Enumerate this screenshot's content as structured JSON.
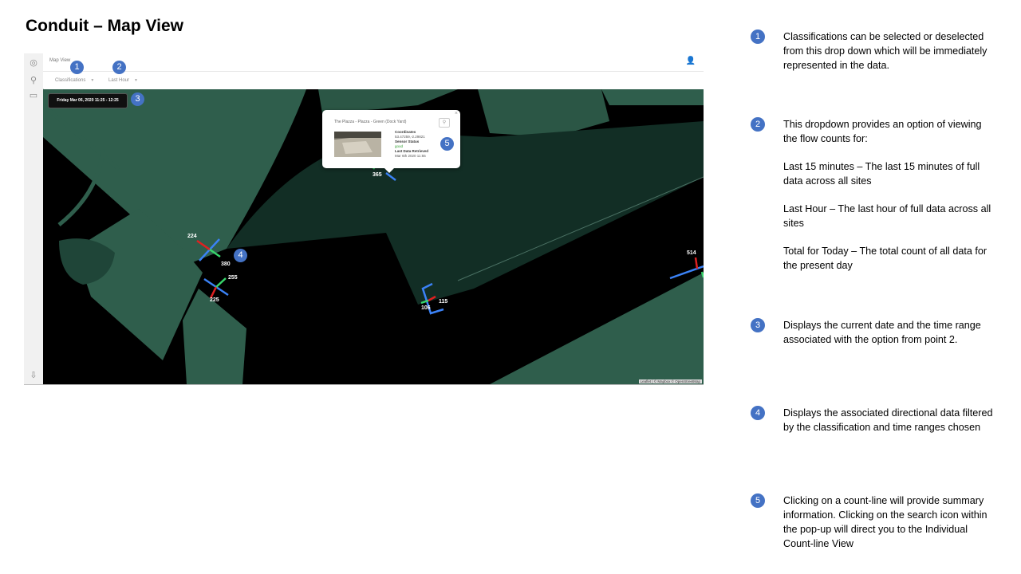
{
  "slide": {
    "title": "Conduit – Map View"
  },
  "app": {
    "breadcrumb": "Map View",
    "filters": {
      "classifications_label": "Classifications",
      "time_range_label": "Last Hour"
    },
    "date_range": "Friday Mar 06, 2020 11:25 - 12:25",
    "popup": {
      "title": "The Plazza - Plazza - Green (Dock Yard)",
      "coordinates_label": "Coordinates",
      "coordinates": "53.47259,-2.29821",
      "sensor_status_label": "Sensor Status",
      "sensor_status": "good",
      "last_retrieved_label": "Last Data Retrieved",
      "last_retrieved": "Mar 6th 2020 11:55"
    },
    "counts": [
      "224",
      "380",
      "255",
      "225",
      "365",
      "115",
      "106",
      "514"
    ],
    "attribution": "Leaflet | © Mapbox © OpenStreetMap",
    "colors": {
      "map_green": "#2f5e4c",
      "road": "#000000",
      "line_blue": "#3b82f6",
      "arrow_red": "#e02020",
      "arrow_green": "#38d66b",
      "badge": "#4472c4"
    }
  },
  "badges": [
    "1",
    "2",
    "3",
    "4",
    "5"
  ],
  "notes": [
    {
      "num": "1",
      "paragraphs": [
        "Classifications can be selected or deselected from this drop down which will be immediately represented in the data."
      ]
    },
    {
      "num": "2",
      "paragraphs": [
        "This dropdown provides an option of viewing the flow counts for:",
        "Last 15 minutes – The last 15 minutes of full data across all sites",
        "Last Hour – The last hour of full data across all sites",
        "Total for Today – The total count of all data for the present day"
      ]
    },
    {
      "num": "3",
      "paragraphs": [
        "Displays the current date and the time range associated with the option from point 2."
      ]
    },
    {
      "num": "4",
      "paragraphs": [
        "Displays the associated directional data filtered by the classification and time ranges chosen"
      ]
    },
    {
      "num": "5",
      "paragraphs": [
        "Clicking on a count-line will provide summary information. Clicking on the search icon within the pop-up will direct you to the Individual Count-line View"
      ]
    }
  ]
}
